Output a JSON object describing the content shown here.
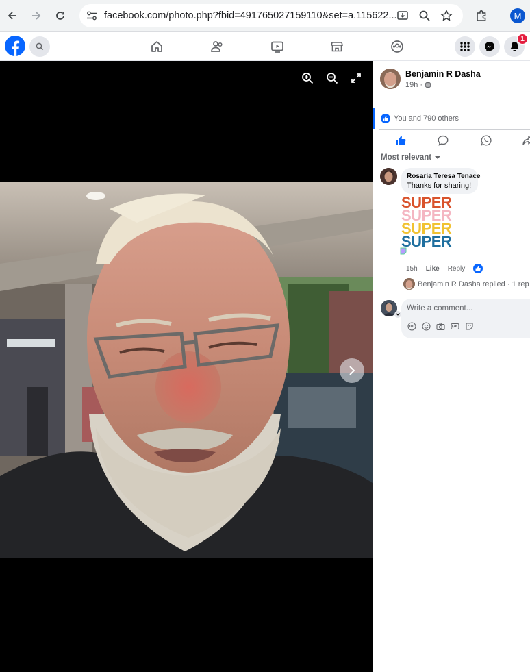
{
  "browser": {
    "url": "facebook.com/photo.php?fbid=491765027159110&set=a.115622...",
    "profile_initial": "M"
  },
  "header": {
    "notification_count": "1"
  },
  "post": {
    "author": "Benjamin R Dasha",
    "time": "19h",
    "reactions_text": "You and 790 others"
  },
  "comments": {
    "sort_label": "Most relevant",
    "items": [
      {
        "author": "Rosaria Teresa Tenace",
        "text": "Thanks for sharing!",
        "sticker_words": [
          "SUPER",
          "SUPER",
          "SUPER",
          "SUPER"
        ],
        "time": "15h",
        "like_label": "Like",
        "reply_label": "Reply"
      }
    ],
    "replies_text": "Benjamin R Dasha replied · 1 rep",
    "input_placeholder": "Write a comment..."
  },
  "colors": {
    "fb_blue": "#0866ff",
    "badge_red": "#e41e3f",
    "sticker": [
      "#d9532c",
      "#f4b6c2",
      "#f1c232",
      "#1f6f9f"
    ]
  }
}
